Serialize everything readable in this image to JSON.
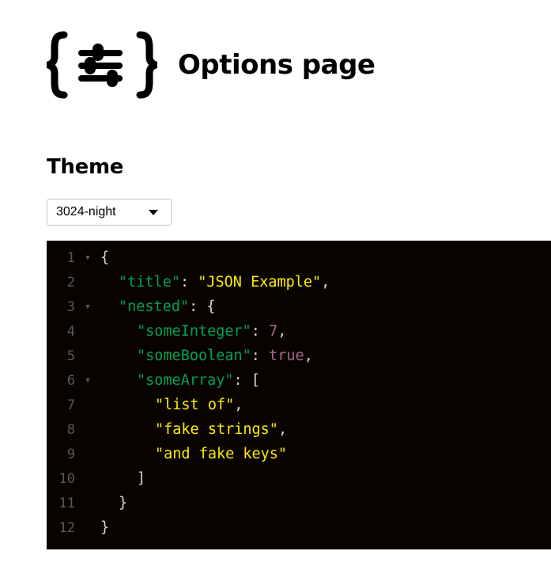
{
  "page": {
    "title": "Options page"
  },
  "theme": {
    "heading": "Theme",
    "selected": "3024-night"
  },
  "editor": {
    "lines": [
      {
        "num": "1",
        "fold": true,
        "indent": 0,
        "tokens": [
          {
            "t": "{",
            "c": "p"
          }
        ]
      },
      {
        "num": "2",
        "fold": false,
        "indent": 1,
        "tokens": [
          {
            "t": "\"title\"",
            "c": "k"
          },
          {
            "t": ": ",
            "c": "p"
          },
          {
            "t": "\"JSON Example\"",
            "c": "s"
          },
          {
            "t": ",",
            "c": "p"
          }
        ]
      },
      {
        "num": "3",
        "fold": true,
        "indent": 1,
        "tokens": [
          {
            "t": "\"nested\"",
            "c": "k"
          },
          {
            "t": ": {",
            "c": "p"
          }
        ]
      },
      {
        "num": "4",
        "fold": false,
        "indent": 2,
        "tokens": [
          {
            "t": "\"someInteger\"",
            "c": "k"
          },
          {
            "t": ": ",
            "c": "p"
          },
          {
            "t": "7",
            "c": "n"
          },
          {
            "t": ",",
            "c": "p"
          }
        ]
      },
      {
        "num": "5",
        "fold": false,
        "indent": 2,
        "tokens": [
          {
            "t": "\"someBoolean\"",
            "c": "k"
          },
          {
            "t": ": ",
            "c": "p"
          },
          {
            "t": "true",
            "c": "n"
          },
          {
            "t": ",",
            "c": "p"
          }
        ]
      },
      {
        "num": "6",
        "fold": true,
        "indent": 2,
        "tokens": [
          {
            "t": "\"someArray\"",
            "c": "k"
          },
          {
            "t": ": [",
            "c": "p"
          }
        ]
      },
      {
        "num": "7",
        "fold": false,
        "indent": 3,
        "tokens": [
          {
            "t": "\"list of\"",
            "c": "s"
          },
          {
            "t": ",",
            "c": "p"
          }
        ]
      },
      {
        "num": "8",
        "fold": false,
        "indent": 3,
        "tokens": [
          {
            "t": "\"fake strings\"",
            "c": "s"
          },
          {
            "t": ",",
            "c": "p"
          }
        ]
      },
      {
        "num": "9",
        "fold": false,
        "indent": 3,
        "tokens": [
          {
            "t": "\"and fake keys\"",
            "c": "s"
          }
        ]
      },
      {
        "num": "10",
        "fold": false,
        "indent": 2,
        "tokens": [
          {
            "t": "]",
            "c": "p"
          }
        ]
      },
      {
        "num": "11",
        "fold": false,
        "indent": 1,
        "tokens": [
          {
            "t": "}",
            "c": "p"
          }
        ]
      },
      {
        "num": "12",
        "fold": false,
        "indent": 0,
        "tokens": [
          {
            "t": "}",
            "c": "p"
          }
        ]
      }
    ]
  },
  "icons": {
    "logo": "json-settings-logo-icon",
    "fold_marker": "fold-arrow-icon",
    "dropdown": "caret-down-icon"
  },
  "colors": {
    "editor_bg": "#090300",
    "key": "#01a252",
    "string": "#fded02",
    "number_bool": "#a16a94",
    "punctuation": "#d6d5d4",
    "gutter": "#5c5855"
  }
}
